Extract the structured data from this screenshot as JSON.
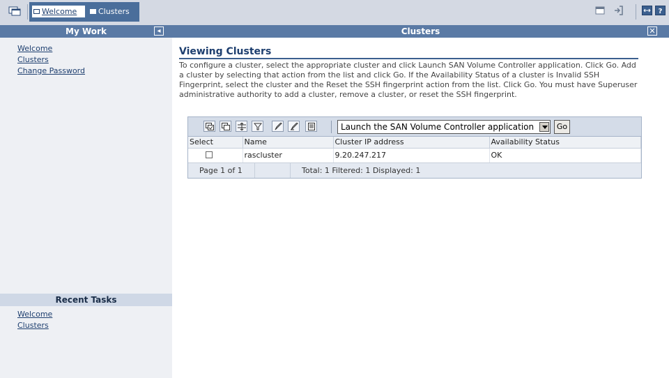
{
  "tabs": [
    {
      "label": "Welcome"
    },
    {
      "label": "Clusters"
    }
  ],
  "left": {
    "my_work_title": "My Work",
    "links": [
      "Welcome",
      "Clusters",
      "Change Password"
    ],
    "recent_title": "Recent Tasks",
    "recent_links": [
      "Welcome",
      "Clusters"
    ]
  },
  "main": {
    "header": "Clusters",
    "title": "Viewing Clusters",
    "intro": "To configure a cluster, select the appropriate cluster and click Launch SAN Volume Controller application. Click Go. Add a cluster by selecting that action from the list and click Go. If the Availability Status of a cluster is Invalid SSH Fingerprint, select the cluster and the Reset the SSH fingerprint action from the list. Click Go. You must have Superuser administrative authority to add a cluster, remove a cluster, or reset the SSH fingerprint."
  },
  "table": {
    "action_selected": "Launch the SAN Volume Controller application",
    "go_label": "Go",
    "columns": [
      "Select",
      "Name",
      "Cluster IP address",
      "Availability Status"
    ],
    "rows": [
      {
        "name": "rascluster",
        "ip": "9.20.247.217",
        "status": "OK"
      }
    ],
    "page_label": "Page 1 of 1",
    "totals_label": "Total: 1 Filtered: 1 Displayed: 1"
  },
  "colors": {
    "header_blue": "#5a7aa5",
    "link": "#1e3f6f",
    "panel_bg": "#eef0f4"
  },
  "icons": [
    "window-icon",
    "minimize-icon",
    "logout-icon",
    "expand-icon",
    "help-icon",
    "close-icon",
    "collapse-icon"
  ]
}
